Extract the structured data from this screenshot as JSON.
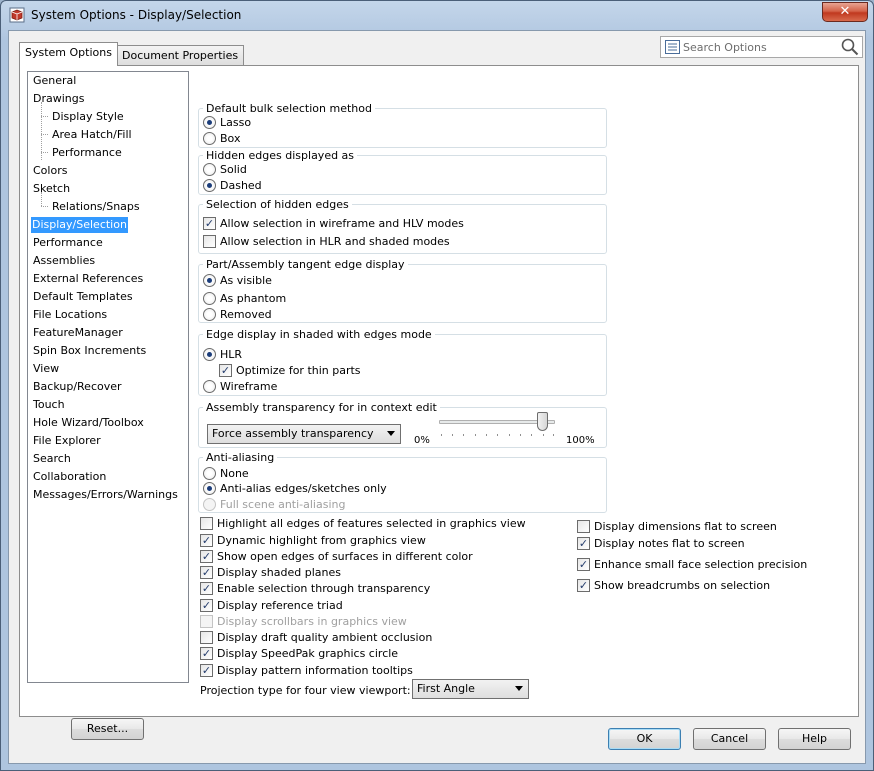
{
  "window": {
    "title": "System Options - Display/Selection",
    "close_label": "✕"
  },
  "tabs": [
    "System Options",
    "Document Properties"
  ],
  "search": {
    "placeholder": "Search Options"
  },
  "tree": {
    "items": [
      {
        "label": "General",
        "level": 0
      },
      {
        "label": "Drawings",
        "level": 0
      },
      {
        "label": "Display Style",
        "level": 1
      },
      {
        "label": "Area Hatch/Fill",
        "level": 1
      },
      {
        "label": "Performance",
        "level": 1
      },
      {
        "label": "Colors",
        "level": 0
      },
      {
        "label": "Sketch",
        "level": 0
      },
      {
        "label": "Relations/Snaps",
        "level": 1
      },
      {
        "label": "Display/Selection",
        "level": 0,
        "selected": true
      },
      {
        "label": "Performance",
        "level": 0
      },
      {
        "label": "Assemblies",
        "level": 0
      },
      {
        "label": "External References",
        "level": 0
      },
      {
        "label": "Default Templates",
        "level": 0
      },
      {
        "label": "File Locations",
        "level": 0
      },
      {
        "label": "FeatureManager",
        "level": 0
      },
      {
        "label": "Spin Box Increments",
        "level": 0
      },
      {
        "label": "View",
        "level": 0
      },
      {
        "label": "Backup/Recover",
        "level": 0
      },
      {
        "label": "Touch",
        "level": 0
      },
      {
        "label": "Hole Wizard/Toolbox",
        "level": 0
      },
      {
        "label": "File Explorer",
        "level": 0
      },
      {
        "label": "Search",
        "level": 0
      },
      {
        "label": "Collaboration",
        "level": 0
      },
      {
        "label": "Messages/Errors/Warnings",
        "level": 0
      }
    ]
  },
  "reset_label": "Reset...",
  "groups": {
    "bulk": {
      "title": "Default bulk selection method",
      "options": [
        {
          "label": "Lasso",
          "checked": true
        },
        {
          "label": "Box",
          "checked": false
        }
      ]
    },
    "hidden": {
      "title": "Hidden edges displayed as",
      "options": [
        {
          "label": "Solid",
          "checked": false
        },
        {
          "label": "Dashed",
          "checked": true
        }
      ]
    },
    "selhidden": {
      "title": "Selection of hidden edges",
      "options": [
        {
          "label": "Allow selection in wireframe and HLV modes",
          "checked": true
        },
        {
          "label": "Allow selection in HLR and shaded modes",
          "checked": false
        }
      ]
    },
    "tangent": {
      "title": "Part/Assembly tangent edge display",
      "options": [
        {
          "label": "As visible",
          "checked": true
        },
        {
          "label": "As phantom",
          "checked": false
        },
        {
          "label": "Removed",
          "checked": false
        }
      ]
    },
    "edgeshaded": {
      "title": "Edge display in shaded with edges mode",
      "options": [
        {
          "label": "HLR",
          "checked": true
        },
        {
          "label": "Optimize for thin parts",
          "checked": true
        },
        {
          "label": "Wireframe",
          "checked": false
        }
      ]
    },
    "transparency": {
      "title": "Assembly transparency for in context edit",
      "combo": "Force assembly transparency",
      "min_label": "0%",
      "max_label": "100%",
      "level": 0.9
    },
    "antialias": {
      "title": "Anti-aliasing",
      "options": [
        {
          "label": "None",
          "checked": false
        },
        {
          "label": "Anti-alias edges/sketches only",
          "checked": true
        },
        {
          "label": "Full scene anti-aliasing",
          "checked": false,
          "disabled": true
        }
      ]
    }
  },
  "checks_left": [
    {
      "label": "Highlight all edges of features selected in graphics view",
      "checked": false
    },
    {
      "label": "Dynamic highlight from graphics view",
      "checked": true
    },
    {
      "label": "Show open edges of surfaces in different color",
      "checked": true
    },
    {
      "label": "Display shaded planes",
      "checked": true
    },
    {
      "label": "Enable selection through transparency",
      "checked": true
    },
    {
      "label": "Display reference triad",
      "checked": true
    },
    {
      "label": "Display scrollbars in graphics view",
      "checked": false,
      "disabled": true
    },
    {
      "label": "Display draft quality ambient occlusion",
      "checked": false
    },
    {
      "label": "Display SpeedPak graphics circle",
      "checked": true
    },
    {
      "label": "Display pattern information tooltips",
      "checked": true
    }
  ],
  "checks_right": [
    {
      "label": "Display dimensions flat to screen",
      "checked": false
    },
    {
      "label": "Display notes flat to screen",
      "checked": true
    },
    {
      "label": "Enhance small face selection precision",
      "checked": true
    },
    {
      "label": "Show breadcrumbs on selection",
      "checked": true
    }
  ],
  "projection": {
    "label": "Projection type for four view viewport:",
    "value": "First Angle"
  },
  "buttons": {
    "ok": "OK",
    "cancel": "Cancel",
    "help": "Help"
  }
}
